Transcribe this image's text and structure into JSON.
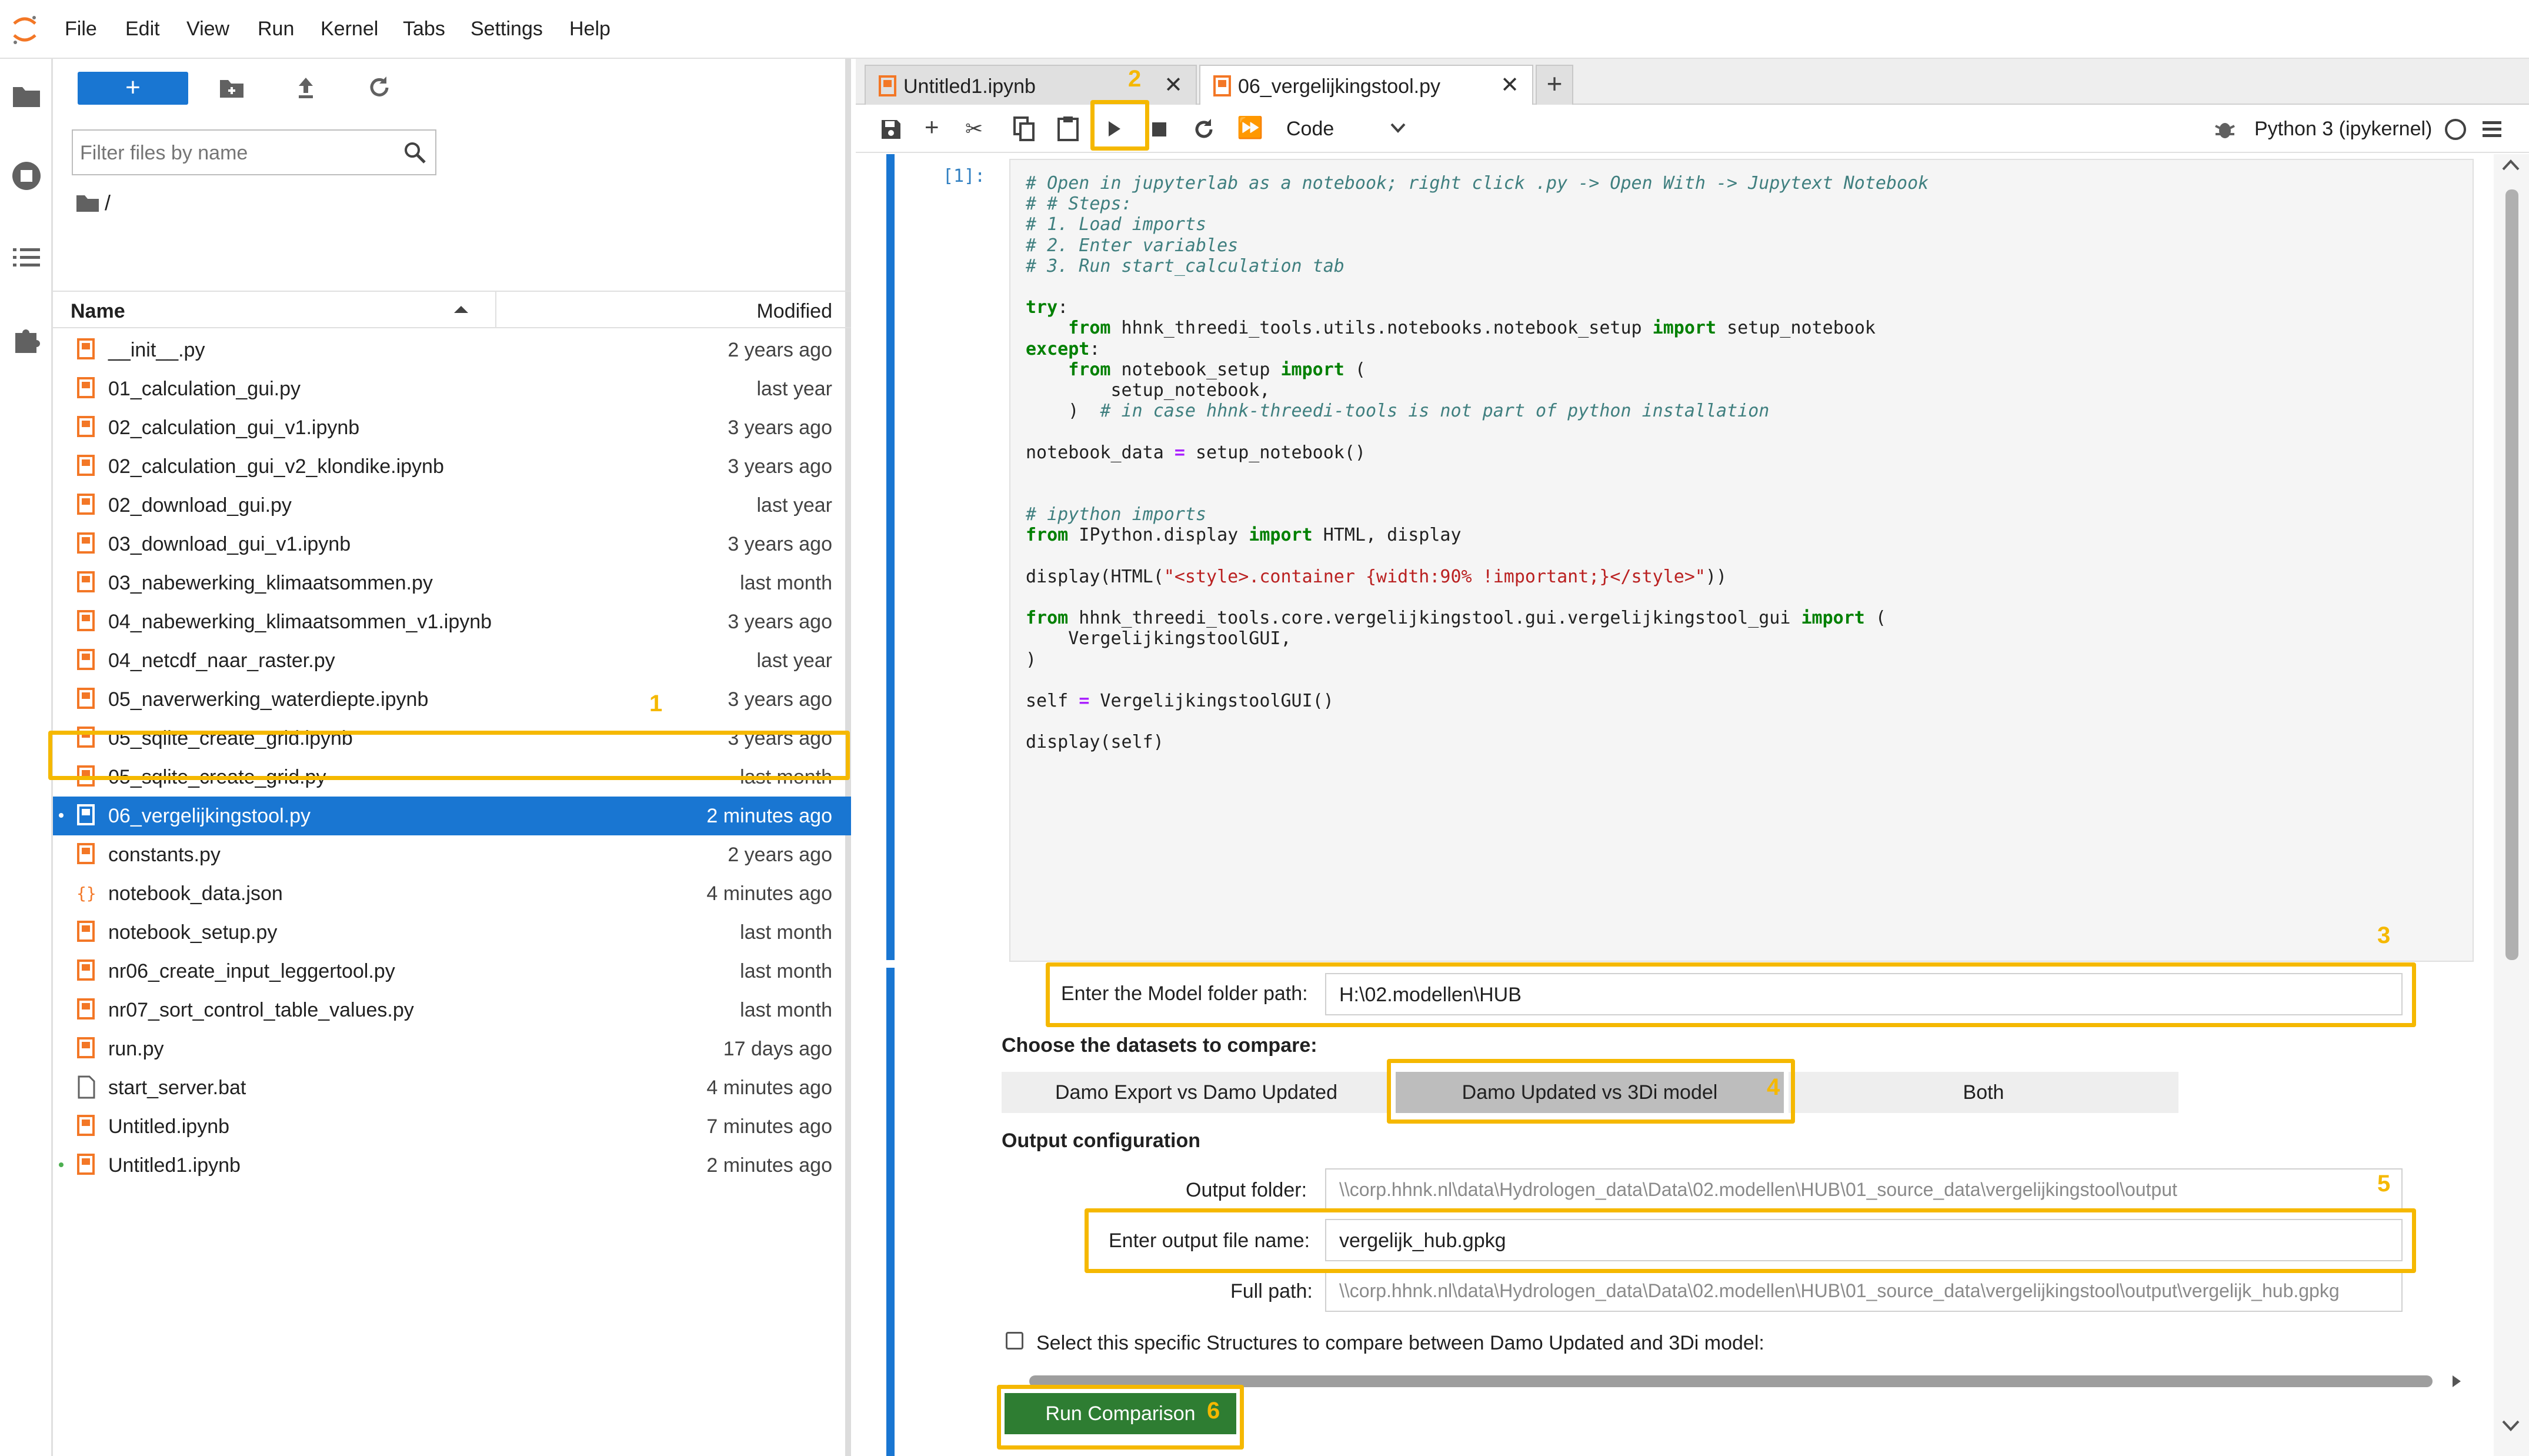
{
  "menubar": {
    "items": [
      "File",
      "Edit",
      "View",
      "Run",
      "Kernel",
      "Tabs",
      "Settings",
      "Help"
    ]
  },
  "leftbar": {
    "icons": [
      "folder-icon",
      "running-icon",
      "toc-icon",
      "extension-icon"
    ]
  },
  "filebrowser": {
    "new_label": "+",
    "filter_placeholder": "Filter files by name",
    "path": "/",
    "col_name": "Name",
    "col_modified": "Modified",
    "files": [
      {
        "name": "__init__.py",
        "modified": "2 years ago",
        "icon": "py-icon"
      },
      {
        "name": "01_calculation_gui.py",
        "modified": "last year",
        "icon": "py-icon"
      },
      {
        "name": "02_calculation_gui_v1.ipynb",
        "modified": "3 years ago",
        "icon": "notebook-icon"
      },
      {
        "name": "02_calculation_gui_v2_klondike.ipynb",
        "modified": "3 years ago",
        "icon": "notebook-icon"
      },
      {
        "name": "02_download_gui.py",
        "modified": "last year",
        "icon": "py-icon"
      },
      {
        "name": "03_download_gui_v1.ipynb",
        "modified": "3 years ago",
        "icon": "notebook-icon"
      },
      {
        "name": "03_nabewerking_klimaatsommen.py",
        "modified": "last month",
        "icon": "py-icon"
      },
      {
        "name": "04_nabewerking_klimaatsommen_v1.ipynb",
        "modified": "3 years ago",
        "icon": "notebook-icon"
      },
      {
        "name": "04_netcdf_naar_raster.py",
        "modified": "last year",
        "icon": "py-icon"
      },
      {
        "name": "05_naverwerking_waterdiepte.ipynb",
        "modified": "3 years ago",
        "icon": "notebook-icon"
      },
      {
        "name": "05_sqlite_create_grid.ipynb",
        "modified": "3 years ago",
        "icon": "notebook-icon"
      },
      {
        "name": "05_sqlite_create_grid.py",
        "modified": "last month",
        "icon": "py-icon"
      },
      {
        "name": "06_vergelijkingstool.py",
        "modified": "2 minutes ago",
        "icon": "py-icon"
      },
      {
        "name": "constants.py",
        "modified": "2 years ago",
        "icon": "py-icon"
      },
      {
        "name": "notebook_data.json",
        "modified": "4 minutes ago",
        "icon": "json-icon"
      },
      {
        "name": "notebook_setup.py",
        "modified": "last month",
        "icon": "py-icon"
      },
      {
        "name": "nr06_create_input_leggertool.py",
        "modified": "last month",
        "icon": "py-icon"
      },
      {
        "name": "nr07_sort_control_table_values.py",
        "modified": "last month",
        "icon": "py-icon"
      },
      {
        "name": "run.py",
        "modified": "17 days ago",
        "icon": "py-icon"
      },
      {
        "name": "start_server.bat",
        "modified": "4 minutes ago",
        "icon": "file-icon"
      },
      {
        "name": "Untitled.ipynb",
        "modified": "7 minutes ago",
        "icon": "notebook-icon"
      },
      {
        "name": "Untitled1.ipynb",
        "modified": "2 minutes ago",
        "icon": "notebook-icon"
      }
    ]
  },
  "tabs": [
    {
      "label": "Untitled1.ipynb"
    },
    {
      "label": "06_vergelijkingstool.py"
    }
  ],
  "toolbar": {
    "cell_type": "Code",
    "kernel": "Python 3 (ipykernel)"
  },
  "cell": {
    "prompt": "[1]:",
    "lines": [
      "# Open in jupyterlab as a notebook; right click .py -> Open With -> Jupytext Notebook",
      "# # Steps:",
      "# 1. Load imports",
      "# 2. Enter variables",
      "# 3. Run start_calculation tab",
      "",
      "try:",
      "    from hhnk_threedi_tools.utils.notebooks.notebook_setup import setup_notebook",
      "except:",
      "    from notebook_setup import (",
      "        setup_notebook,",
      "    )  # in case hhnk-threedi-tools is not part of python installation",
      "",
      "notebook_data = setup_notebook()",
      "",
      "",
      "# ipython imports",
      "from IPython.display import HTML, display",
      "",
      "display(HTML(\"<style>.container {width:90% !important;}</style>\"))",
      "",
      "from hhnk_threedi_tools.core.vergelijkingstool.gui.vergelijkingstool_gui import (",
      "    VergelijkingstoolGUI,",
      ")",
      "",
      "self = VergelijkingstoolGUI()",
      "",
      "display(self)"
    ]
  },
  "gui": {
    "model_folder_label": "Enter the Model folder path:",
    "model_folder_value": "H:\\02.modellen\\HUB",
    "datasets_heading": "Choose the datasets to compare:",
    "toggle_options": [
      "Damo Export vs Damo Updated",
      "Damo Updated vs 3Di model",
      "Both"
    ],
    "toggle_selected": "Damo Updated vs 3Di model",
    "output_heading": "Output configuration",
    "output_folder_label": "Output folder:",
    "output_folder_value": "\\\\corp.hhnk.nl\\data\\Hydrologen_data\\Data\\02.modellen\\HUB\\01_source_data\\vergelijkingstool\\output",
    "output_file_label": "Enter output file name:",
    "output_file_value": "vergelijk_hub.gpkg",
    "full_path_label": "Full path:",
    "full_path_value": "\\\\corp.hhnk.nl\\data\\Hydrologen_data\\Data\\02.modellen\\HUB\\01_source_data\\vergelijkingstool\\output\\vergelijk_hub.gpkg",
    "checkbox_label": "Select this specific Structures to compare between Damo Updated and 3Di model:",
    "checkbox_checked": false,
    "run_button": "Run Comparison"
  },
  "annotations": [
    "1",
    "2",
    "3",
    "4",
    "5",
    "6"
  ],
  "colors": {
    "accent": "#1976d2",
    "highlight": "#f5b800",
    "run_button": "#2e7d32",
    "cell_bar": "#1976d2"
  }
}
